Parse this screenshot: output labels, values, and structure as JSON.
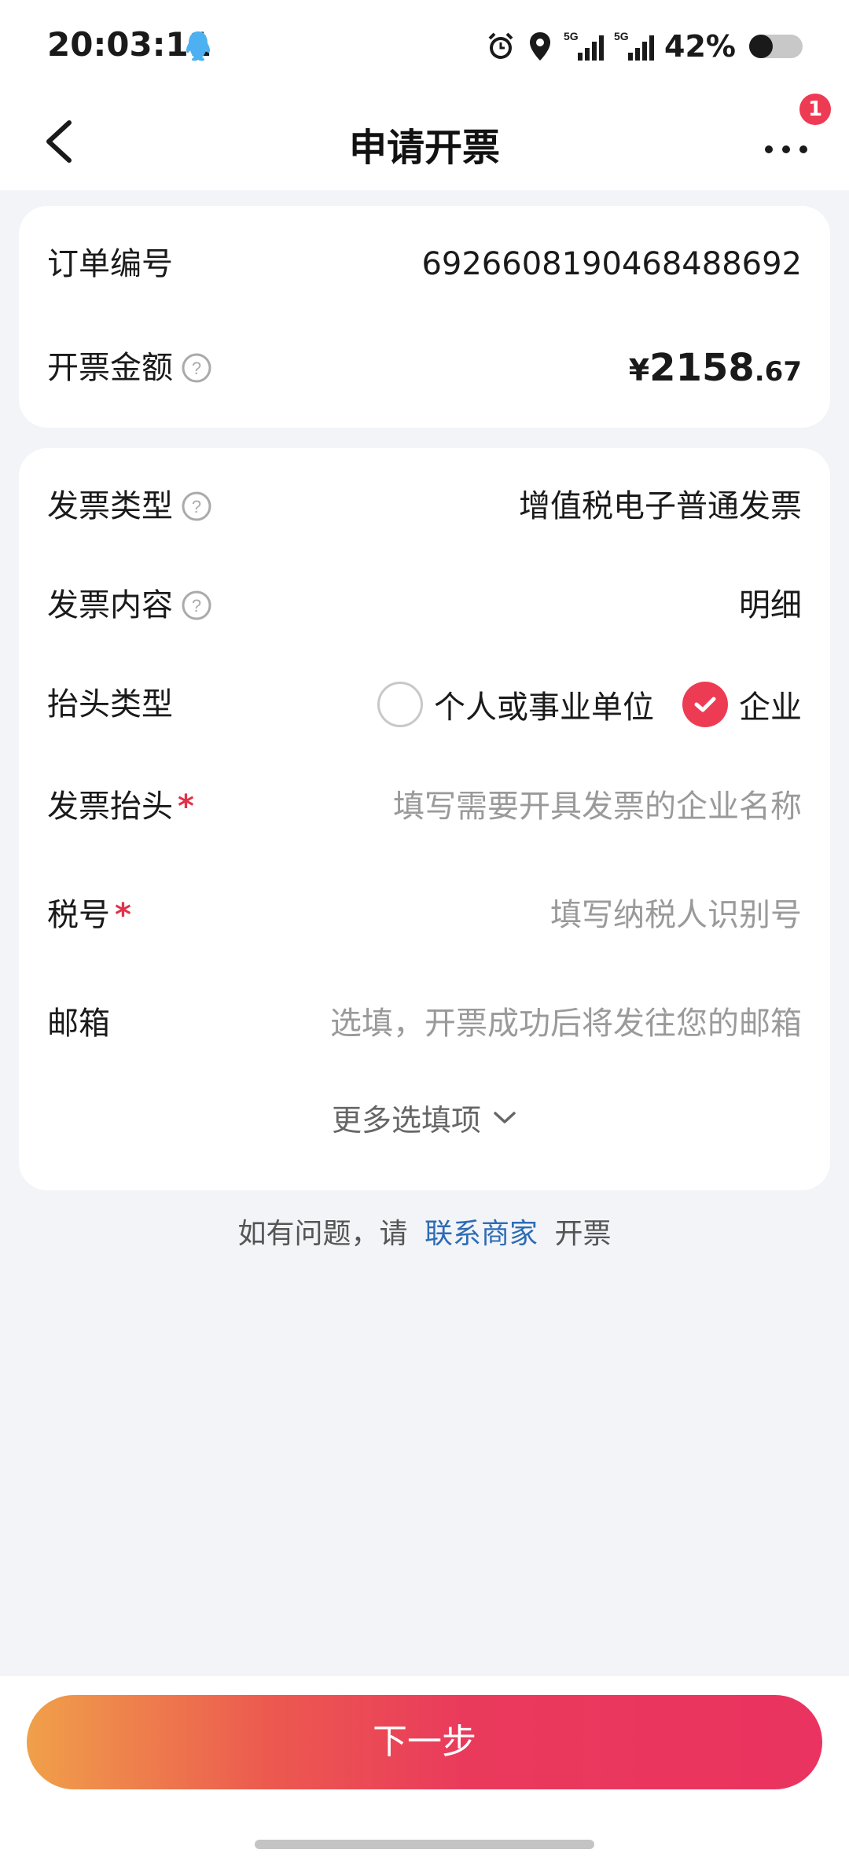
{
  "status_bar": {
    "time": "20:03:11",
    "network_1": "5G",
    "network_2": "5G",
    "battery": "42%"
  },
  "nav": {
    "title": "申请开票",
    "badge": "1"
  },
  "order": {
    "order_no_label": "订单编号",
    "order_no": "6926608190468488692",
    "amount_label": "开票金额",
    "amount_currency": "¥",
    "amount_int": "2158",
    "amount_dec": ".67"
  },
  "invoice": {
    "type_label": "发票类型",
    "type_value": "增值税电子普通发票",
    "content_label": "发票内容",
    "content_value": "明细",
    "header_type_label": "抬头类型",
    "header_type_options": [
      "个人或事业单位",
      "企业"
    ],
    "header_type_selected": "企业",
    "title_label": "发票抬头",
    "title_placeholder": "填写需要开具发票的企业名称",
    "tax_label": "税号",
    "tax_placeholder": "填写纳税人识别号",
    "email_label": "邮箱",
    "email_placeholder": "选填，开票成功后将发往您的邮箱",
    "required_mark": "*",
    "more_fields": "更多选填项"
  },
  "help": {
    "prefix": "如有问题，请",
    "link": "联系商家",
    "suffix": "开票"
  },
  "footer": {
    "next_label": "下一步"
  },
  "colors": {
    "accent": "#ee3b54",
    "link": "#2d6cb5",
    "background": "#f3f4f8"
  }
}
